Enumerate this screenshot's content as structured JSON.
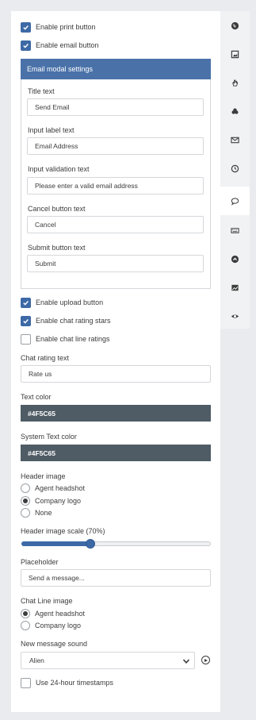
{
  "checkboxes": {
    "print": {
      "label": "Enable print button",
      "checked": true
    },
    "email": {
      "label": "Enable email button",
      "checked": true
    },
    "upload": {
      "label": "Enable upload button",
      "checked": true
    },
    "rating_stars": {
      "label": "Enable chat rating stars",
      "checked": true
    },
    "line_ratings": {
      "label": "Enable chat line ratings",
      "checked": false
    },
    "timestamps": {
      "label": "Use 24-hour timestamps",
      "checked": false
    }
  },
  "email_modal": {
    "heading": "Email modal settings",
    "title_label": "Title text",
    "title_value": "Send Email",
    "input_label_label": "Input label text",
    "input_label_value": "Email Address",
    "validation_label": "Input validation text",
    "validation_value": "Please enter a valid email address",
    "cancel_label": "Cancel button text",
    "cancel_value": "Cancel",
    "submit_label": "Submit button text",
    "submit_value": "Submit"
  },
  "chat_rating": {
    "label": "Chat rating text",
    "value": "Rate us"
  },
  "text_color": {
    "label": "Text color",
    "value": "#4F5C65"
  },
  "system_text_color": {
    "label": "System Text color",
    "value": "#4F5C65"
  },
  "header_image": {
    "label": "Header image",
    "options": [
      "Agent headshot",
      "Company logo",
      "None"
    ],
    "selected": "Company logo"
  },
  "header_scale": {
    "label": "Header image scale (70%)",
    "percent": 70
  },
  "placeholder": {
    "label": "Placeholder",
    "value": "Send a message..."
  },
  "chat_line_image": {
    "label": "Chat Line image",
    "options": [
      "Agent headshot",
      "Company logo"
    ],
    "selected": "Agent headshot"
  },
  "sound": {
    "label": "New message sound",
    "value": "Alien"
  },
  "rail_icons": [
    "globe-icon",
    "image-icon",
    "hand-icon",
    "people-icon",
    "envelope-icon",
    "clock-icon",
    "chat-bubble-icon",
    "keyboard-icon",
    "circle-up-icon",
    "picture-icon",
    "eye-icon"
  ],
  "colors": {
    "accent": "#3d6aa6",
    "header": "#4a72a9",
    "swatch": "#4f5c65"
  }
}
